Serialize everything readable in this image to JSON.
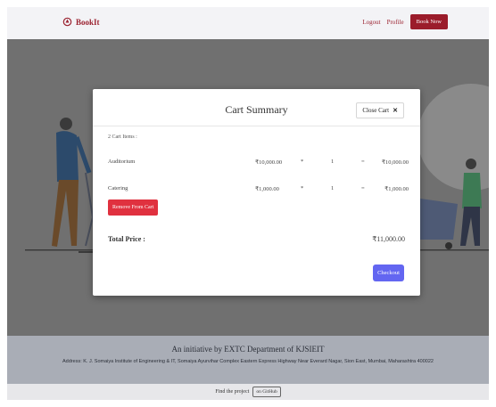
{
  "navbar": {
    "brand": "BookIt",
    "links": [
      "Logout",
      "Profile"
    ],
    "cta": "Book Now"
  },
  "modal": {
    "title": "Cart Summary",
    "close_label": "Close Cart",
    "close_icon": "close-icon",
    "items_count": "2 Cart Items :",
    "items": [
      {
        "name": "Auditorium",
        "price": "₹10,000.00",
        "mult": "*",
        "qty": "1",
        "eq": "=",
        "total": "₹10,000.00"
      },
      {
        "name": "Catering",
        "price": "₹1,000.00",
        "mult": "*",
        "qty": "1",
        "eq": "=",
        "total": "₹1,000.00"
      }
    ],
    "remove_label": "Remove From Cart",
    "total_label": "Total Price :",
    "total_value": "₹11,000.00",
    "checkout_label": "Checkout"
  },
  "footer": {
    "title": "An initiative by EXTC Department of KJSIEIT",
    "address": "Address: K. J. Somaiya Institute of Engineering & IT, Somaiya Ayurvihar Complex Eastern Express Highway Near Everard Nagar, Sion East, Mumbai, Maharashtra 400022",
    "find_text": "Find the project",
    "github_label": "on GitHub"
  },
  "colors": {
    "brand": "#9b2230",
    "remove": "#e0313f",
    "checkout": "#6366f1"
  }
}
